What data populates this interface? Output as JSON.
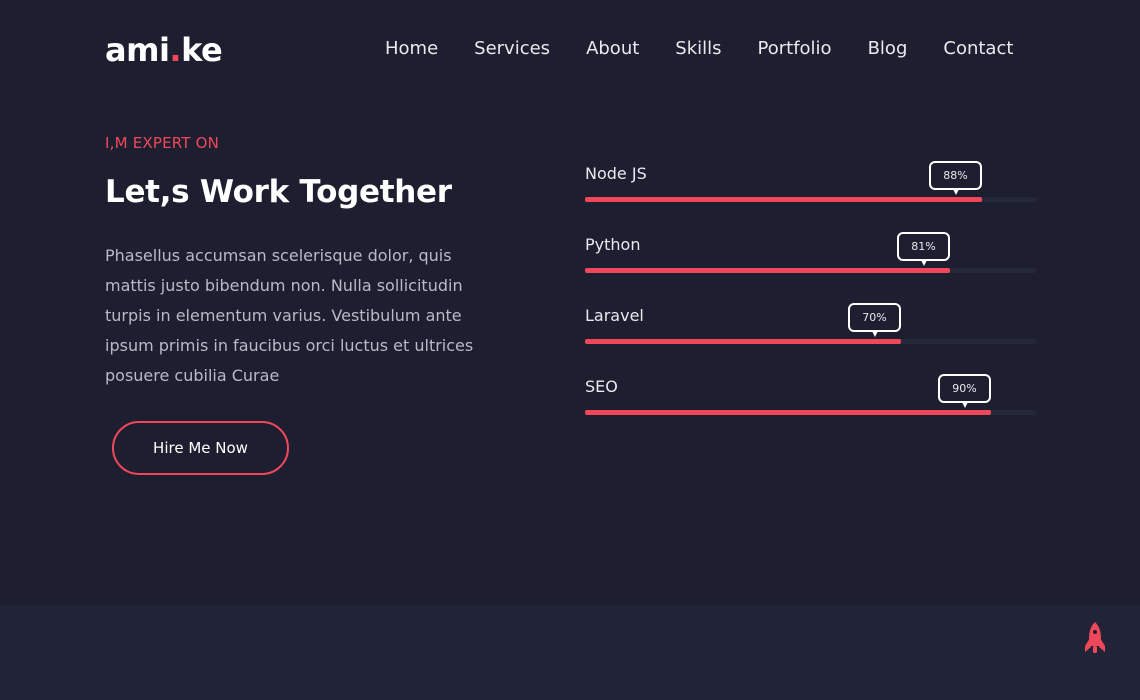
{
  "header": {
    "logo_main": "ami",
    "logo_dot": ".",
    "logo_rest": "ke",
    "nav": [
      {
        "label": "Home"
      },
      {
        "label": "Services"
      },
      {
        "label": "About"
      },
      {
        "label": "Skills"
      },
      {
        "label": "Portfolio"
      },
      {
        "label": "Blog"
      },
      {
        "label": "Contact"
      }
    ]
  },
  "intro": {
    "eyebrow": "I,M EXPERT ON",
    "title": "Let,s Work Together",
    "paragraph": "Phasellus accumsan scelerisque dolor, quis mattis justo bibendum non. Nulla sollicitudin turpis in elementum varius. Vestibulum ante ipsum primis in faucibus orci luctus et ultrices posuere cubilia Curae",
    "button_label": "Hire Me Now"
  },
  "skills": [
    {
      "name": "Node JS",
      "percent_label": "88%",
      "value": 0.88
    },
    {
      "name": "Python",
      "percent_label": "81%",
      "value": 0.81
    },
    {
      "name": "Laravel",
      "percent_label": "70%",
      "value": 0.7
    },
    {
      "name": "SEO",
      "percent_label": "90%",
      "value": 0.9
    }
  ],
  "colors": {
    "accent": "#f0485a",
    "background": "#1d1f30",
    "track": "#25283a",
    "text": "#ffffff"
  },
  "icons": {
    "scroll_top": "rocket-icon"
  }
}
